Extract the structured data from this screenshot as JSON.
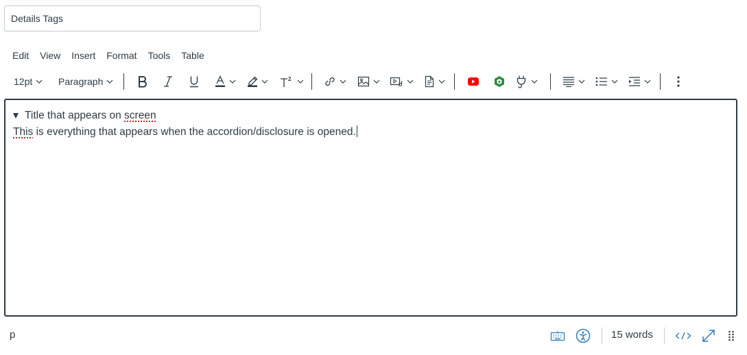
{
  "title_field": {
    "value": "Details Tags"
  },
  "menubar": {
    "items": [
      "Edit",
      "View",
      "Insert",
      "Format",
      "Tools",
      "Table"
    ]
  },
  "toolbar": {
    "font_size": "12pt",
    "block_format": "Paragraph",
    "icons": [
      "bold-icon",
      "italic-icon",
      "underline-icon",
      "text-color-icon",
      "highlight-color-icon",
      "superscript-icon",
      "link-icon",
      "image-icon",
      "media-icon",
      "document-icon",
      "youtube-icon",
      "app-plugin-icon",
      "apps-plug-icon",
      "align-icon",
      "bullet-list-icon",
      "indent-icon",
      "more-icon"
    ],
    "colors": {
      "youtube": "#ff0000",
      "app_plugin": "#2e8b3e"
    }
  },
  "editor": {
    "summary_prefix": "Title that appears on ",
    "summary_misspelled": "screen",
    "body_misspelled": "This",
    "body_rest": " is everything that appears when the accordion/disclosure is opened."
  },
  "statusbar": {
    "path": "p",
    "word_count": "15 words",
    "icons": [
      "keyboard-icon",
      "accessibility-icon",
      "html-source-icon",
      "fullscreen-icon",
      "resize-handle-icon"
    ],
    "accent_color": "#2b7abc"
  }
}
